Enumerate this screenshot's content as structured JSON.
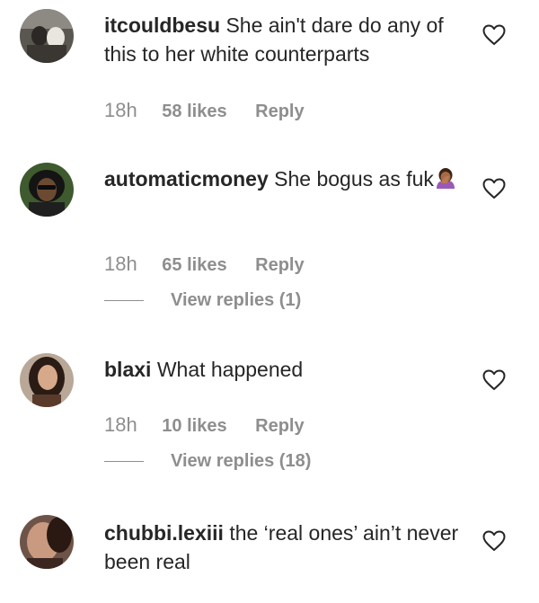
{
  "comments": [
    {
      "username": "itcouldbesu",
      "text": "She ain't dare do any of this to her white counterparts",
      "time": "18h",
      "likes": "58 likes",
      "reply": "Reply",
      "view_replies": ""
    },
    {
      "username": "automaticmoney",
      "text": "She bogus as fuk",
      "emoji": "person-facepalming-emoji",
      "time": "18h",
      "likes": "65 likes",
      "reply": "Reply",
      "view_replies": "View replies (1)"
    },
    {
      "username": "blaxi",
      "text": "What happened",
      "time": "18h",
      "likes": "10 likes",
      "reply": "Reply",
      "view_replies": "View replies (18)"
    },
    {
      "username": "chubbi.lexiii",
      "text": "the ‘real ones’ ain’t never been real",
      "time": "",
      "likes": "",
      "reply": "",
      "view_replies": ""
    }
  ],
  "icons": {
    "like": "heart-outline-icon"
  },
  "colors": {
    "text": "#262626",
    "secondary": "#8e8e8e"
  }
}
